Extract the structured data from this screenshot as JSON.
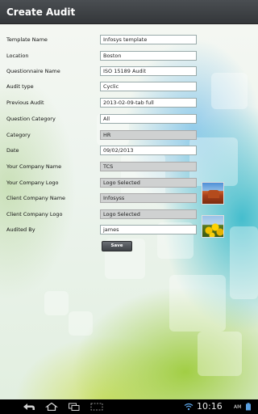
{
  "app": {
    "title": "Create Audit"
  },
  "form": {
    "fields": [
      {
        "label": "Template Name",
        "value": "Infosys template"
      },
      {
        "label": "Location",
        "value": "Boston"
      },
      {
        "label": "Questionnaire Name",
        "value": "ISO 15189 Audit"
      },
      {
        "label": "Audit type",
        "value": "Cyclic"
      },
      {
        "label": "Previous Audit",
        "value": "2013-02-09-tab full"
      },
      {
        "label": "Question Category",
        "value": "All"
      },
      {
        "label": "Category",
        "value": "HR"
      },
      {
        "label": "Date",
        "value": "09/02/2013"
      },
      {
        "label": "Your Company Name",
        "value": "TCS"
      },
      {
        "label": "Your Company Logo",
        "value": "Logo Selected"
      },
      {
        "label": "Client Company Name",
        "value": "Infosyss"
      },
      {
        "label": "Client Company Logo",
        "value": "Logo Selected"
      },
      {
        "label": "Audited By",
        "value": "james"
      }
    ],
    "save_label": "Save"
  },
  "statusbar": {
    "time": "10:16",
    "ampm": "AM"
  },
  "icons": {
    "back": "back-icon",
    "home": "home-icon",
    "recents": "recent-apps-icon",
    "screenshot": "screenshot-icon",
    "wifi": "wifi-icon",
    "battery": "battery-icon"
  }
}
